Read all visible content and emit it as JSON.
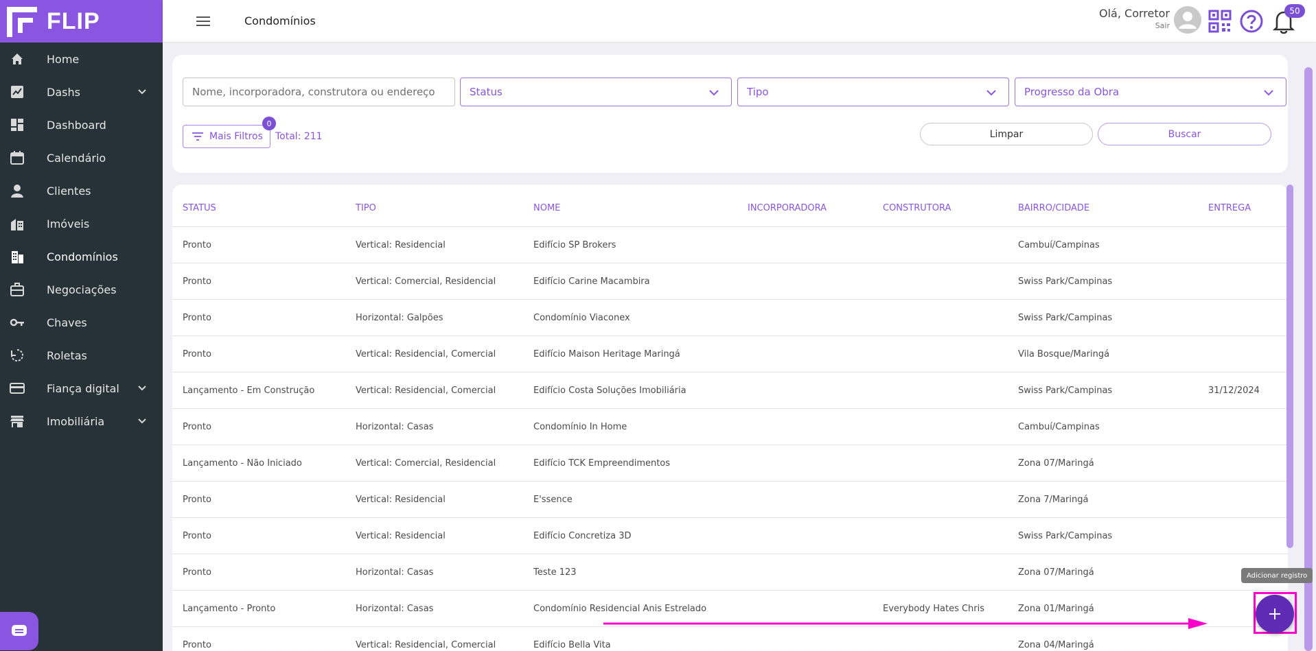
{
  "brand": {
    "name": "FLIP",
    "color": "#8a55e0"
  },
  "sidebar": {
    "items": [
      {
        "label": "Home",
        "icon": "home-icon",
        "expandable": false
      },
      {
        "label": "Dashs",
        "icon": "chart-icon",
        "expandable": true
      },
      {
        "label": "Dashboard",
        "icon": "dashboard-icon",
        "expandable": false
      },
      {
        "label": "Calendário",
        "icon": "calendar-icon",
        "expandable": false
      },
      {
        "label": "Clientes",
        "icon": "person-icon",
        "expandable": false
      },
      {
        "label": "Imóveis",
        "icon": "buildings-icon",
        "expandable": false
      },
      {
        "label": "Condomínios",
        "icon": "apartment-icon",
        "expandable": false,
        "active": true
      },
      {
        "label": "Negociações",
        "icon": "briefcase-icon",
        "expandable": false
      },
      {
        "label": "Chaves",
        "icon": "key-icon",
        "expandable": false
      },
      {
        "label": "Roletas",
        "icon": "roulette-icon",
        "expandable": false
      },
      {
        "label": "Fiança digital",
        "icon": "credit-card-icon",
        "expandable": true
      },
      {
        "label": "Imobiliária",
        "icon": "store-icon",
        "expandable": true
      }
    ]
  },
  "header": {
    "title": "Condomínios",
    "greeting": "Olá, Corretor",
    "logout": "Sair",
    "notifications_count": "50"
  },
  "filters": {
    "search_placeholder": "Nome, incorporadora, construtora ou endereço",
    "status_label": "Status",
    "tipo_label": "Tipo",
    "progresso_label": "Progresso da Obra",
    "more_filters_label": "Mais Filtros",
    "more_filters_count": "0",
    "total_label": "Total: 211",
    "clear_label": "Limpar",
    "search_label": "Buscar"
  },
  "table": {
    "columns": [
      "STATUS",
      "TIPO",
      "NOME",
      "INCORPORADORA",
      "CONSTRUTORA",
      "BAIRRO/CIDADE",
      "ENTREGA"
    ],
    "rows": [
      [
        "Pronto",
        "Vertical: Residencial",
        "Edifício SP Brokers",
        "",
        "",
        "Cambuí/Campinas",
        ""
      ],
      [
        "Pronto",
        "Vertical: Comercial, Residencial",
        "Edifício Carine Macambira",
        "",
        "",
        "Swiss Park/Campinas",
        ""
      ],
      [
        "Pronto",
        "Horizontal: Galpões",
        "Condomínio Viaconex",
        "",
        "",
        "Swiss Park/Campinas",
        ""
      ],
      [
        "Pronto",
        "Vertical: Residencial, Comercial",
        "Edifício Maison Heritage Maringá",
        "",
        "",
        "Vila Bosque/Maringá",
        ""
      ],
      [
        "Lançamento - Em Construção",
        "Vertical: Residencial, Comercial",
        "Edifício Costa Soluções Imobiliária",
        "",
        "",
        "Swiss Park/Campinas",
        "31/12/2024"
      ],
      [
        "Pronto",
        "Horizontal: Casas",
        "Condomínio In Home",
        "",
        "",
        "Cambuí/Campinas",
        ""
      ],
      [
        "Lançamento - Não Iniciado",
        "Vertical: Comercial, Residencial",
        "Edifício TCK Empreendimentos",
        "",
        "",
        "Zona 07/Maringá",
        ""
      ],
      [
        "Pronto",
        "Vertical: Residencial",
        "E'ssence",
        "",
        "",
        "Zona 7/Maringá",
        ""
      ],
      [
        "Pronto",
        "Vertical: Residencial",
        "Edifício Concretiza 3D",
        "",
        "",
        "Swiss Park/Campinas",
        ""
      ],
      [
        "Pronto",
        "Horizontal: Casas",
        "Teste 123",
        "",
        "",
        "Zona 07/Maringá",
        ""
      ],
      [
        "Lançamento - Pronto",
        "Horizontal: Casas",
        "Condomínio Residencial Anis Estrelado",
        "",
        "Everybody Hates Chris",
        "Zona 01/Maringá",
        ""
      ],
      [
        "Pronto",
        "Vertical: Residencial, Comercial",
        "Edifício Bella Vita",
        "",
        "",
        "Zona 04/Maringá",
        ""
      ]
    ]
  },
  "fab": {
    "tooltip": "Adicionar registro"
  }
}
